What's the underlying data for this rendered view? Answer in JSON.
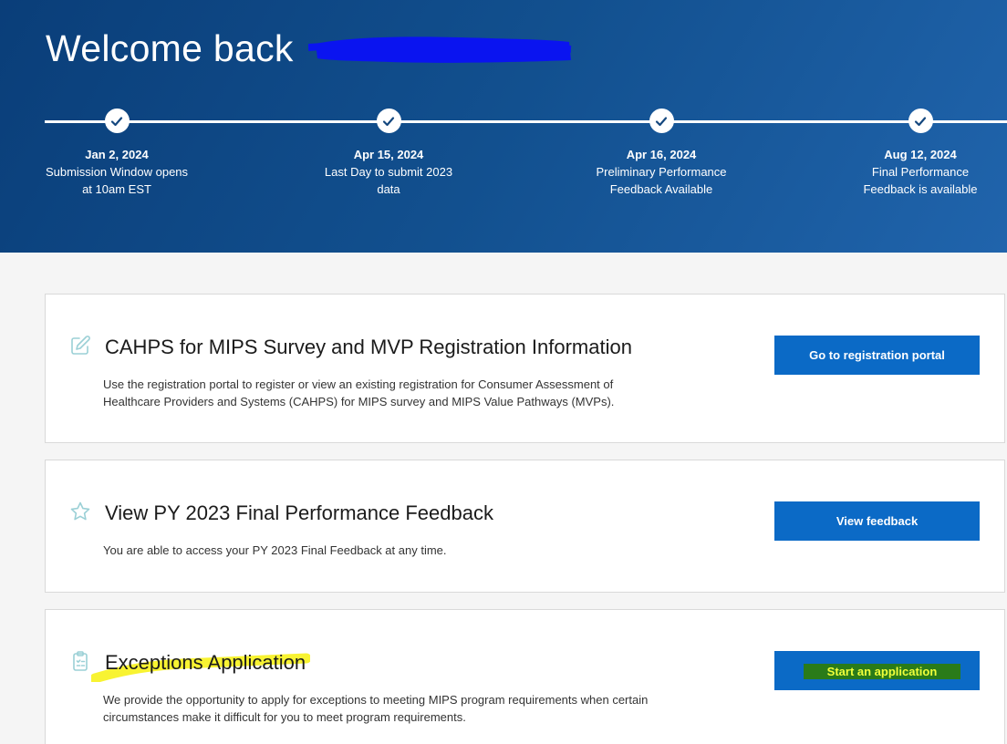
{
  "header": {
    "welcome_text": "Welcome back"
  },
  "timeline": [
    {
      "date": "Jan 2, 2024",
      "line1": "Submission Window opens",
      "line2": "at 10am EST"
    },
    {
      "date": "Apr 15, 2024",
      "line1": "Last Day to submit 2023",
      "line2": "data"
    },
    {
      "date": "Apr 16, 2024",
      "line1": "Preliminary Performance",
      "line2": "Feedback Available"
    },
    {
      "date": "Aug 12, 2024",
      "line1": "Final Performance",
      "line2": "Feedback is available"
    }
  ],
  "cards": [
    {
      "icon": "edit-icon",
      "title": "CAHPS for MIPS Survey and MVP Registration Information",
      "description": "Use the registration portal to register or view an existing registration for Consumer Assessment of Healthcare Providers and Systems (CAHPS) for MIPS survey and MIPS Value Pathways (MVPs).",
      "button": "Go to registration portal"
    },
    {
      "icon": "star-icon",
      "title": "View PY 2023 Final Performance Feedback",
      "description": "You are able to access your PY 2023 Final Feedback at any time.",
      "button": "View feedback"
    },
    {
      "icon": "clipboard-icon",
      "title": "Exceptions Application",
      "description": "We provide the opportunity to apply for exceptions to meeting MIPS program requirements when certain circumstances make it difficult for you to meet program requirements.",
      "button": "Start an application"
    }
  ],
  "colors": {
    "hero_start": "#0a3e79",
    "hero_end": "#2064ac",
    "button": "#0b6ac6",
    "icon": "#9bd0d6",
    "redaction": "#0a14f0",
    "highlight_yellow": "#f7f21c",
    "highlight_green": "#2a7b19"
  }
}
